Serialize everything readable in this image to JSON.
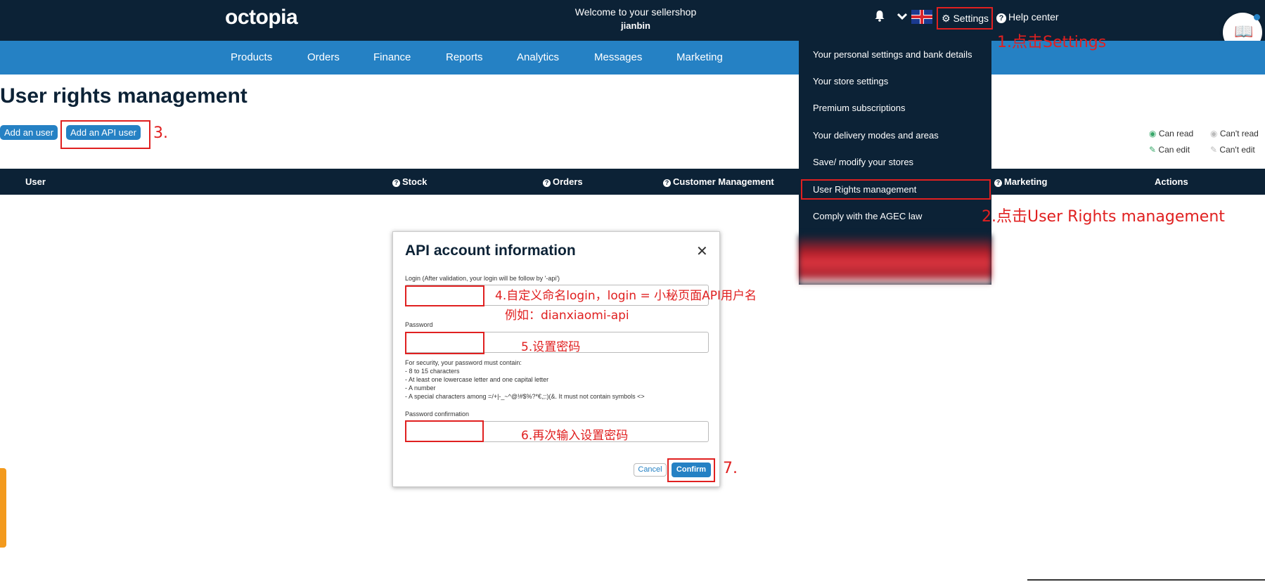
{
  "header": {
    "logo": "octopia",
    "welcome": "Welcome to your sellershop",
    "username": "jianbin",
    "settings_label": "Settings",
    "help_label": "Help center"
  },
  "nav": [
    "Products",
    "Orders",
    "Finance",
    "Reports",
    "Analytics",
    "Messages",
    "Marketing"
  ],
  "page": {
    "title": "User rights management",
    "add_user": "Add an user",
    "add_api_user": "Add an API user"
  },
  "legend": {
    "can_read": "Can read",
    "cant_read": "Can't read",
    "can_edit": "Can edit",
    "cant_edit": "Can't edit"
  },
  "table": {
    "col_user": "User",
    "col_stock": "Stock",
    "col_orders": "Orders",
    "col_customer": "Customer Management",
    "col_marketing": "Marketing",
    "col_actions": "Actions"
  },
  "dropdown": [
    "Your personal settings and bank details",
    "Your store settings",
    "Premium subscriptions",
    "Your delivery modes and areas",
    "Save/ modify your stores",
    "User Rights management",
    "Comply with the AGEC law"
  ],
  "modal": {
    "title": "API account information",
    "login_label": "Login (After validation, your login will be follow by '-api')",
    "password_label": "Password",
    "password_help": "For security, your password must contain:\n- 8 to 15 characters\n- At least one lowercase letter and one capital letter\n- A number\n- A special characters among =/+|-_~^@!#$%?*€,;:)(&. It must not contain symbols <>",
    "confirm_label": "Password confirmation",
    "cancel": "Cancel",
    "confirm": "Confirm"
  },
  "annotations": {
    "a1": "1.点击Settings",
    "a2": "2.点击User Rights management",
    "a3": "3.",
    "a4": "4.自定义命名login，login = 小秘页面API用户名",
    "a4b": "例如：dianxiaomi-api",
    "a5": "5.设置密码",
    "a6": "6.再次输入设置密码",
    "a7": "7."
  }
}
